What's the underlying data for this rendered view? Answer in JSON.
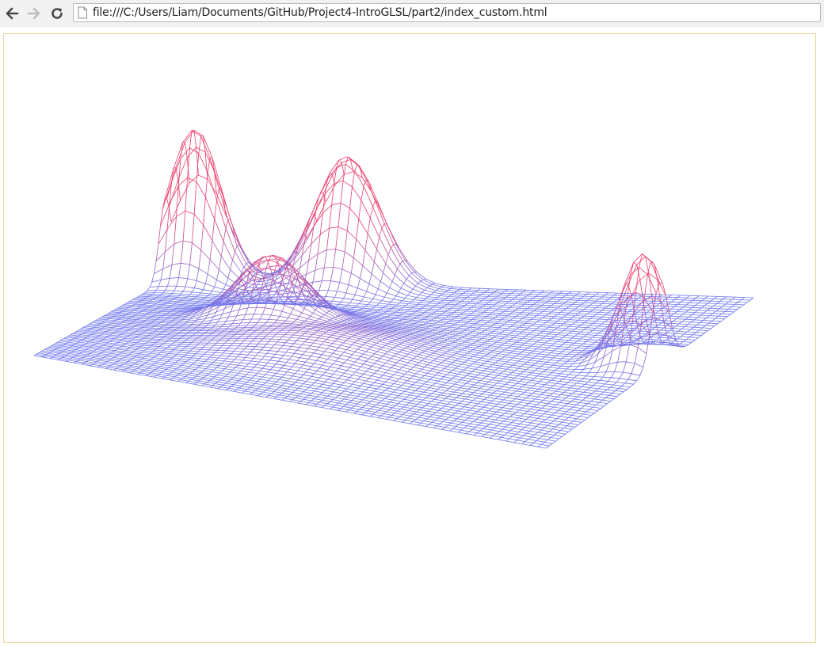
{
  "browser": {
    "address_bar": {
      "url": "file:///C:/Users/Liam/Documents/GitHub/Project4-IntroGLSL/part2/index_custom.html"
    },
    "icons": {
      "back": "back-arrow-icon",
      "forward": "forward-arrow-icon",
      "reload": "reload-icon",
      "page": "page-icon"
    }
  },
  "canvas": {
    "content": "wireframe height-field mesh",
    "colors": {
      "low": "#6f78f0",
      "high": "#ee3f6f",
      "border": "#e8d59a"
    }
  }
}
